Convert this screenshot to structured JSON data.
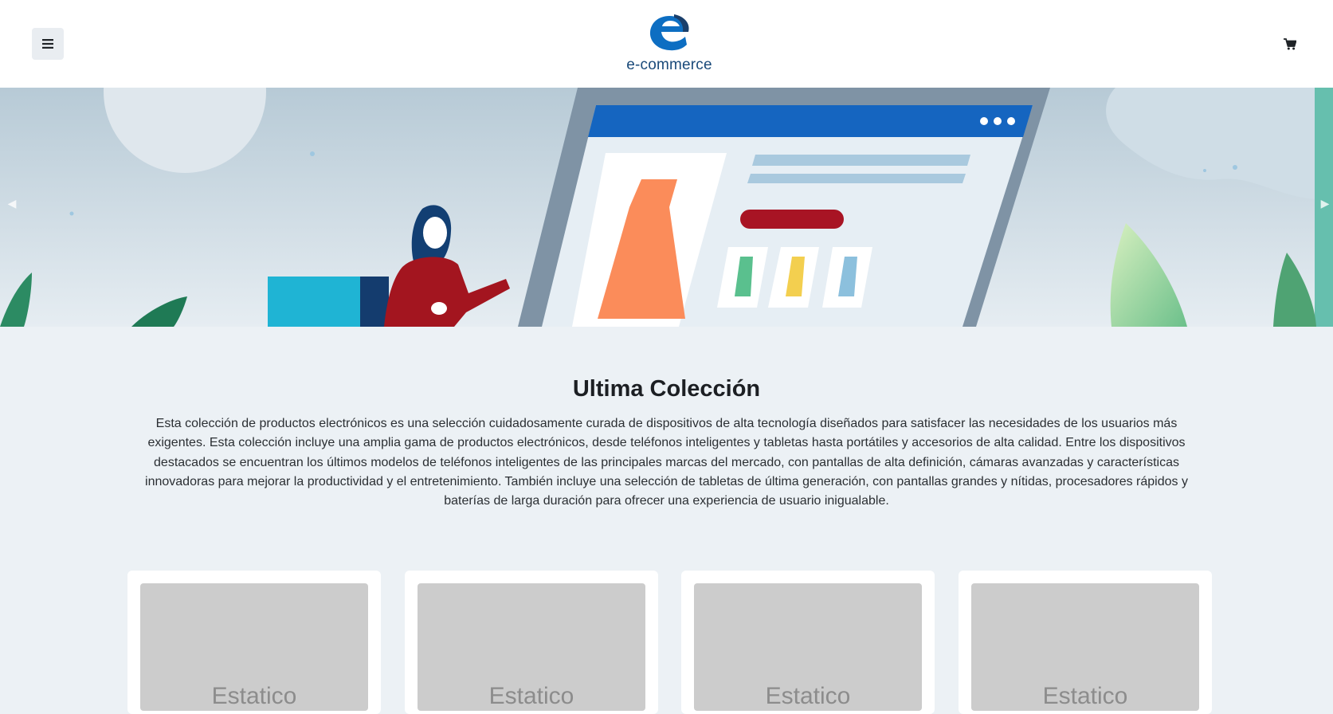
{
  "header": {
    "logo_text": "e-commerce",
    "menu_icon": "hamburger-icon",
    "cart_icon": "shopping-cart-icon"
  },
  "hero": {
    "prev_icon": "chevron-left-icon",
    "next_icon": "chevron-right-icon"
  },
  "collection": {
    "title": "Ultima Colección",
    "description": "Esta colección de productos electrónicos es una selección cuidadosamente curada de dispositivos de alta tecnología diseñados para satisfacer las necesidades de los usuarios más exigentes. Esta colección incluye una amplia gama de productos electrónicos, desde teléfonos inteligentes y tabletas hasta portátiles y accesorios de alta calidad. Entre los dispositivos destacados se encuentran los últimos modelos de teléfonos inteligentes de las principales marcas del mercado, con pantallas de alta definición, cámaras avanzadas y características innovadoras para mejorar la productividad y el entretenimiento. También incluye una selección de tabletas de última generación, con pantallas grandes y nítidas, procesadores rápidos y baterías de larga duración para ofrecer una experiencia de usuario inigualable."
  },
  "products": [
    {
      "image_label": "Estatico"
    },
    {
      "image_label": "Estatico"
    },
    {
      "image_label": "Estatico"
    },
    {
      "image_label": "Estatico"
    }
  ],
  "colors": {
    "background": "#ecf1f5",
    "header": "#ffffff",
    "brand_blue": "#0d6ec2",
    "brand_text": "#1a4a7a",
    "placeholder": "#cccccc"
  }
}
